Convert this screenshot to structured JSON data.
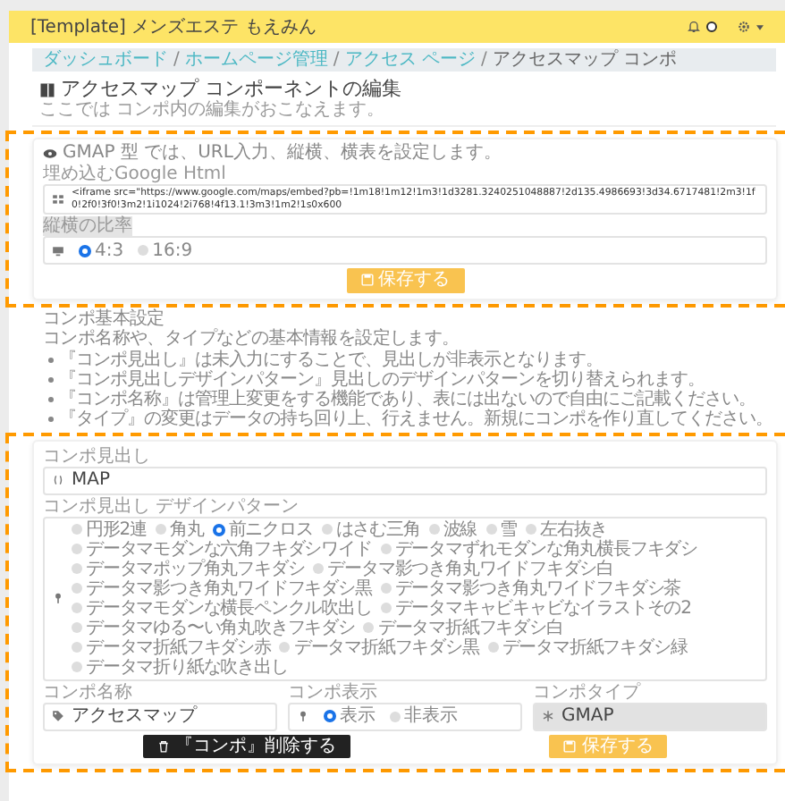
{
  "header": {
    "title": "[Template] メンズエステ もえみん",
    "notification_dot": true
  },
  "breadcrumb": {
    "separator": "/",
    "items": [
      {
        "label": "ダッシュボード",
        "current": false
      },
      {
        "label": "ホームページ管理",
        "current": false
      },
      {
        "label": "アクセス ページ",
        "current": false
      },
      {
        "label": "アクセスマップ コンポ",
        "current": true
      }
    ]
  },
  "page": {
    "title": "アクセスマップ コンポーネントの編集",
    "subtitle": "ここでは コンポ内の編集がおこなえます。"
  },
  "map_card": {
    "note": "GMAP 型 では、URL入力、縦横、横表を設定します。",
    "html_label": "埋め込むGoogle Html",
    "html_value": "<iframe src=\"https://www.google.com/maps/embed?pb=!1m18!1m12!1m3!1d3281.3240251048887!2d135.4986693!3d34.6717481!2m3!1f0!2f0!3f0!3m2!1i1024!2i768!4f13.1!3m3!1m2!1s0x600",
    "ratio_label": "縦横の比率",
    "ratios": [
      {
        "label": "4:3",
        "selected": true
      },
      {
        "label": "16:9",
        "selected": false
      }
    ],
    "save_button": "保存する"
  },
  "basic_section": {
    "title": "コンポ基本設定",
    "description": "コンポ名称や、タイプなどの基本情報を設定します。",
    "bullets": [
      "『コンポ見出し』は未入力にすることで、見出しが非表示となります。",
      "『コンポ見出しデザインパターン』見出しのデザインパターンを切り替えられます。",
      "『コンポ名称』は管理上変更をする機能であり、表には出ないので自由にご記載ください。",
      "『タイプ』の変更はデータの持ち回り上、行えません。新規にコンポを作り直してください。"
    ]
  },
  "basic_card": {
    "heading_label": "コンポ見出し",
    "heading_value": "MAP",
    "pattern_label": "コンポ見出し デザインパターン",
    "patterns": [
      {
        "label": "円形2連",
        "selected": false
      },
      {
        "label": "角丸",
        "selected": false
      },
      {
        "label": "前ニクロス",
        "selected": true
      },
      {
        "label": "はさむ三角",
        "selected": false
      },
      {
        "label": "波線",
        "selected": false
      },
      {
        "label": "雪",
        "selected": false
      },
      {
        "label": "左右抜き",
        "selected": false
      },
      {
        "label": "データマモダンな六角フキダシワイド",
        "selected": false
      },
      {
        "label": "データマずれモダンな角丸横長フキダシ",
        "selected": false
      },
      {
        "label": "データマポップ角丸フキダシ",
        "selected": false
      },
      {
        "label": "データマ影つき角丸ワイドフキダシ白",
        "selected": false
      },
      {
        "label": "データマ影つき角丸ワイドフキダシ黒",
        "selected": false
      },
      {
        "label": "データマ影つき角丸ワイドフキダシ茶",
        "selected": false
      },
      {
        "label": "データマモダンな横長ペンクル吹出し",
        "selected": false
      },
      {
        "label": "データマキャビキャビなイラストその2",
        "selected": false
      },
      {
        "label": "データマゆる〜い角丸吹きフキダシ",
        "selected": false
      },
      {
        "label": "データマ折紙フキダシ白",
        "selected": false
      },
      {
        "label": "データマ折紙フキダシ赤",
        "selected": false
      },
      {
        "label": "データマ折紙フキダシ黒",
        "selected": false
      },
      {
        "label": "データマ折紙フキダシ緑",
        "selected": false
      },
      {
        "label": "データマ折り紙な吹き出し",
        "selected": false
      }
    ],
    "name_label": "コンポ名称",
    "name_value": "アクセスマップ",
    "display_label": "コンポ表示",
    "display": [
      {
        "label": "表示",
        "selected": true
      },
      {
        "label": "非表示",
        "selected": false
      }
    ],
    "type_label": "コンポタイプ",
    "type_value": "GMAP",
    "type_disabled": true,
    "delete_button": "『コンポ』削除する",
    "save_button": "保存する"
  }
}
